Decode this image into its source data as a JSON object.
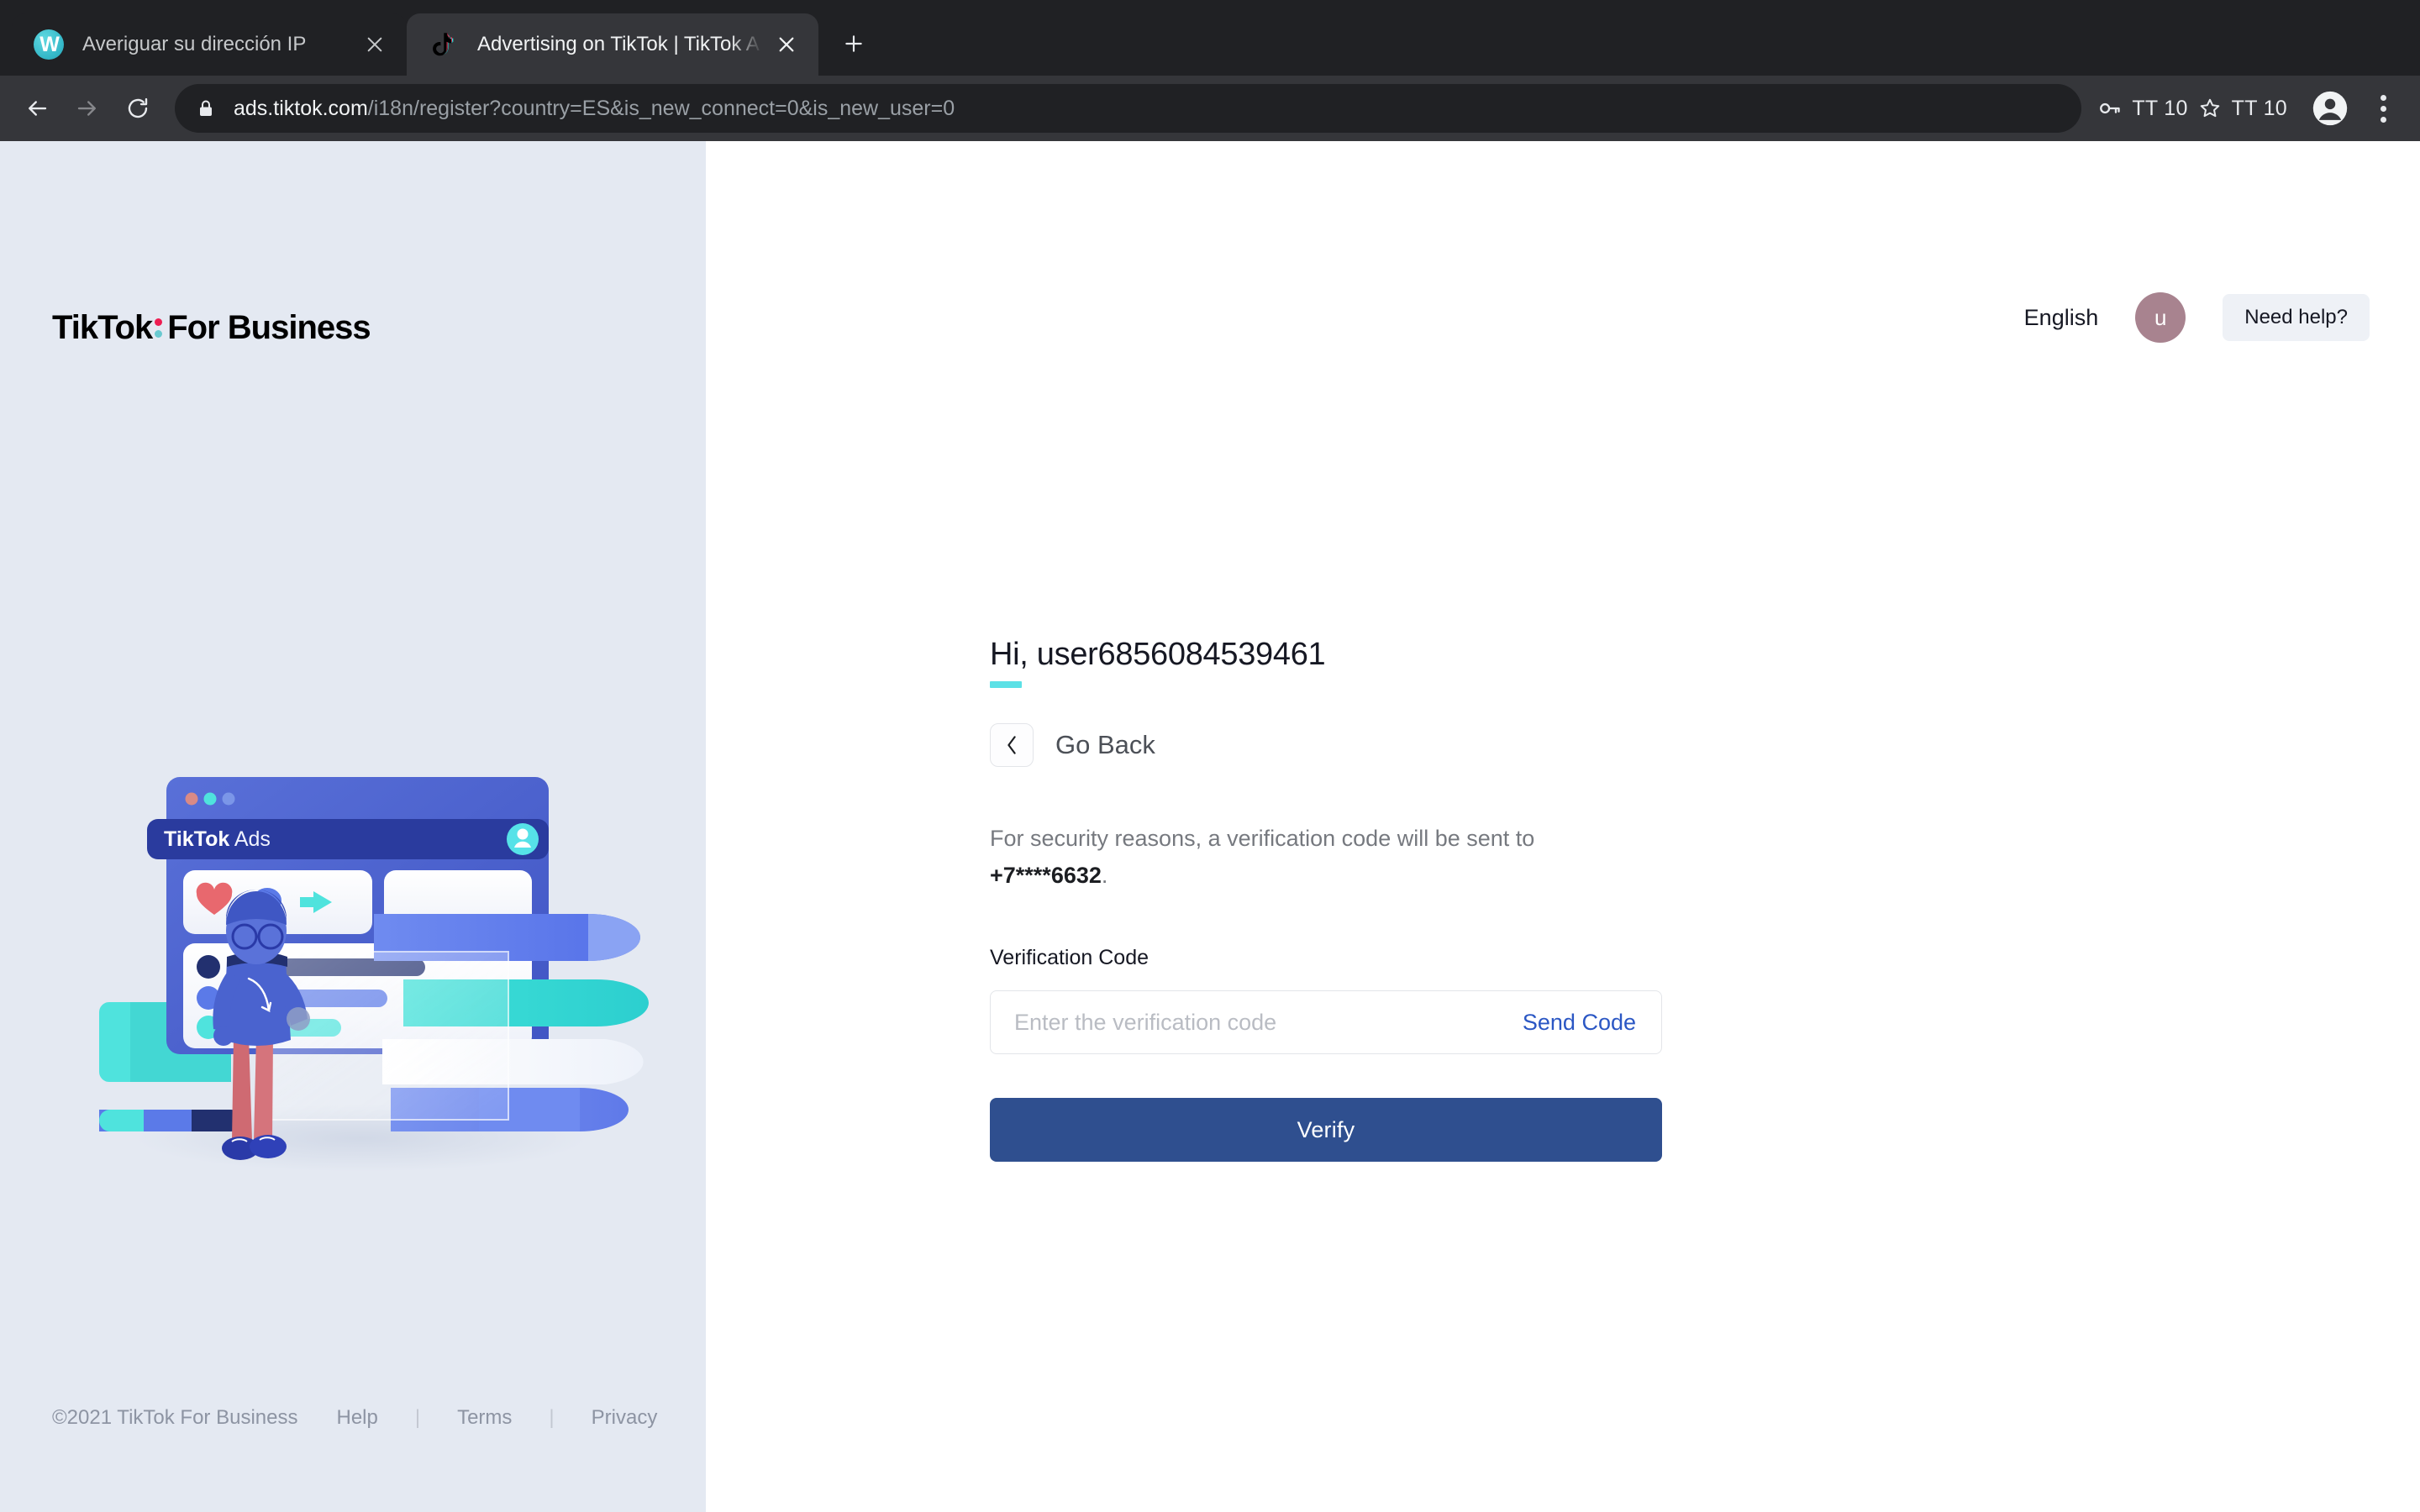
{
  "browser": {
    "tabs": [
      {
        "title": "Averiguar su dirección IP",
        "favicon": "w-globe-icon",
        "active": false
      },
      {
        "title": "Advertising on TikTok | TikTok A",
        "favicon": "tiktok-note-icon",
        "active": true
      }
    ],
    "new_tab_label": "+",
    "nav": {
      "back": "back-arrow-icon",
      "forward": "forward-arrow-icon",
      "reload": "reload-icon"
    },
    "omnibox": {
      "lock": "lock-icon",
      "url_domain": "ads.tiktok.com",
      "url_path": "/i18n/register?country=ES&is_new_connect=0&is_new_user=0",
      "full_url": "ads.tiktok.com/i18n/register?country=ES&is_new_connect=0&is_new_user=0"
    },
    "toolbar_items": [
      {
        "icon": "key-icon",
        "label": "TT 10"
      },
      {
        "icon": "star-icon",
        "label": "TT 10"
      }
    ],
    "profile_icon": "account-circle-icon",
    "menu_icon": "three-dot-menu-icon"
  },
  "sidebar": {
    "brand": {
      "tiktok": "TikTok",
      "for_business": "For Business",
      "dot_top_color": "#ee1d52",
      "dot_bottom_color": "#69c9d0"
    },
    "illustration": {
      "window_title_bold": "TikTok",
      "window_title_light": " Ads",
      "alt": "3d-tiktok-ads-illustration"
    },
    "footer": {
      "copyright": "©2021 TikTok For Business",
      "links": [
        "Help",
        "Terms",
        "Privacy"
      ],
      "separator": "|"
    },
    "bg_color": "#e4e9f2"
  },
  "header": {
    "language": "English",
    "avatar_initial": "u",
    "avatar_color": "#a8838f",
    "need_help": "Need help?"
  },
  "form": {
    "greeting": "Hi, user6856084539461",
    "accent_color": "#5ce1e6",
    "go_back": "Go Back",
    "back_icon": "chevron-left-icon",
    "security_text": "For security reasons, a verification code will be sent to ",
    "phone": "+7****6632",
    "security_text_end": ".",
    "field_label": "Verification Code",
    "input_value": "",
    "input_placeholder": "Enter the verification code",
    "send_code": "Send Code",
    "send_code_color": "#2b57c4",
    "verify": "Verify",
    "verify_color": "#2f4f8f"
  }
}
